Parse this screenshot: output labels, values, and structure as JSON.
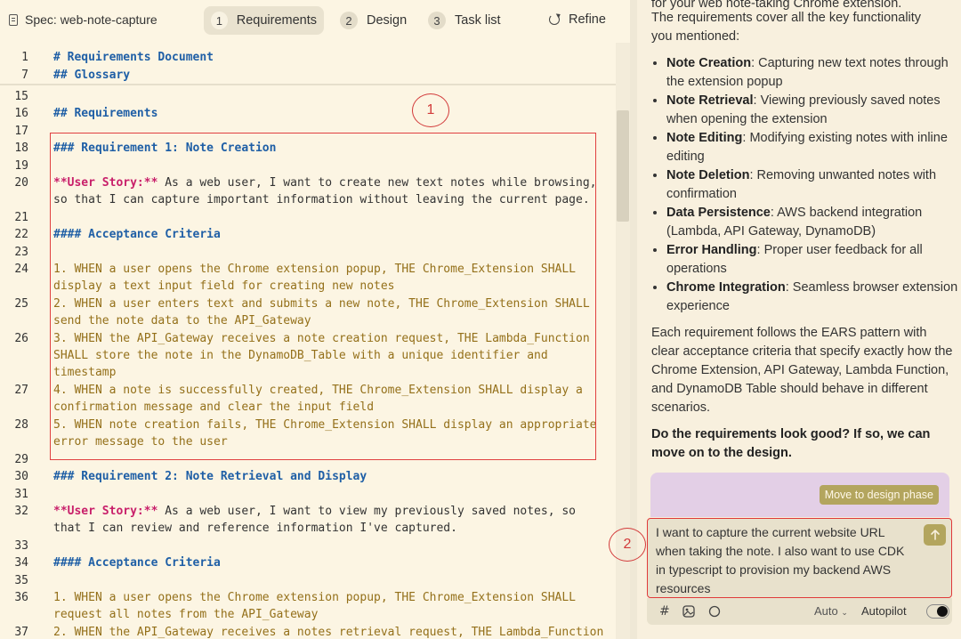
{
  "header": {
    "spec_label": "Spec: web-note-capture",
    "tabs": [
      {
        "num": "1",
        "label": "Requirements",
        "active": true
      },
      {
        "num": "2",
        "label": "Design",
        "active": false
      },
      {
        "num": "3",
        "label": "Task list",
        "active": false
      }
    ],
    "refine_label": "Refine"
  },
  "editor": {
    "lines": [
      {
        "n": "1",
        "parts": [
          {
            "c": "h",
            "t": "# Requirements Document"
          }
        ]
      },
      {
        "n": "7",
        "parts": [
          {
            "c": "h",
            "t": "## Glossary"
          }
        ]
      },
      {
        "n": "15",
        "parts": []
      },
      {
        "n": "16",
        "parts": [
          {
            "c": "h",
            "t": "## Requirements"
          }
        ]
      },
      {
        "n": "17",
        "parts": []
      },
      {
        "n": "18",
        "parts": [
          {
            "c": "h",
            "t": "### Requirement 1: Note Creation"
          }
        ]
      },
      {
        "n": "19",
        "parts": []
      },
      {
        "n": "20",
        "parts": [
          {
            "c": "us",
            "t": "**User Story:**"
          },
          {
            "c": "pl",
            "t": " As a web user, I want to create new text notes while browsing,"
          }
        ]
      },
      {
        "n": "",
        "parts": [
          {
            "c": "pl",
            "t": "so that I can capture important information without leaving the current page."
          }
        ]
      },
      {
        "n": "21",
        "parts": []
      },
      {
        "n": "22",
        "parts": [
          {
            "c": "h",
            "t": "#### Acceptance Criteria"
          }
        ]
      },
      {
        "n": "23",
        "parts": []
      },
      {
        "n": "24",
        "parts": [
          {
            "c": "t",
            "t": "1. WHEN a user opens the Chrome extension popup, THE Chrome_Extension SHALL"
          }
        ]
      },
      {
        "n": "",
        "parts": [
          {
            "c": "t",
            "t": "display a text input field for creating new notes"
          }
        ]
      },
      {
        "n": "25",
        "parts": [
          {
            "c": "t",
            "t": "2. WHEN a user enters text and submits a new note, THE Chrome_Extension SHALL"
          }
        ]
      },
      {
        "n": "",
        "parts": [
          {
            "c": "t",
            "t": "send the note data to the API_Gateway"
          }
        ]
      },
      {
        "n": "26",
        "parts": [
          {
            "c": "t",
            "t": "3. WHEN the API_Gateway receives a note creation request, THE Lambda_Function"
          }
        ]
      },
      {
        "n": "",
        "parts": [
          {
            "c": "t",
            "t": "SHALL store the note in the DynamoDB_Table with a unique identifier and"
          }
        ]
      },
      {
        "n": "",
        "parts": [
          {
            "c": "t",
            "t": "timestamp"
          }
        ]
      },
      {
        "n": "27",
        "parts": [
          {
            "c": "t",
            "t": "4. WHEN a note is successfully created, THE Chrome_Extension SHALL display a"
          }
        ]
      },
      {
        "n": "",
        "parts": [
          {
            "c": "t",
            "t": "confirmation message and clear the input field"
          }
        ]
      },
      {
        "n": "28",
        "parts": [
          {
            "c": "t",
            "t": "5. WHEN note creation fails, THE Chrome_Extension SHALL display an appropriate"
          }
        ]
      },
      {
        "n": "",
        "parts": [
          {
            "c": "t",
            "t": "error message to the user"
          }
        ]
      },
      {
        "n": "29",
        "parts": []
      },
      {
        "n": "30",
        "parts": [
          {
            "c": "h",
            "t": "### Requirement 2: Note Retrieval and Display"
          }
        ]
      },
      {
        "n": "31",
        "parts": []
      },
      {
        "n": "32",
        "parts": [
          {
            "c": "us",
            "t": "**User Story:**"
          },
          {
            "c": "pl",
            "t": " As a web user, I want to view my previously saved notes, so"
          }
        ]
      },
      {
        "n": "",
        "parts": [
          {
            "c": "pl",
            "t": "that I can review and reference information I've captured."
          }
        ]
      },
      {
        "n": "33",
        "parts": []
      },
      {
        "n": "34",
        "parts": [
          {
            "c": "h",
            "t": "#### Acceptance Criteria"
          }
        ]
      },
      {
        "n": "35",
        "parts": []
      },
      {
        "n": "36",
        "parts": [
          {
            "c": "t",
            "t": "1. WHEN a user opens the Chrome extension popup, THE Chrome_Extension SHALL"
          }
        ]
      },
      {
        "n": "",
        "parts": [
          {
            "c": "t",
            "t": "request all notes from the API_Gateway"
          }
        ]
      },
      {
        "n": "37",
        "parts": [
          {
            "c": "t",
            "t": "2. WHEN the API_Gateway receives a notes retrieval request, THE Lambda_Function"
          }
        ]
      }
    ],
    "markers": [
      "1",
      "2"
    ]
  },
  "chat": {
    "intro_line1": "for your web note-taking Chrome extension.",
    "intro_line2": "The requirements cover all the key functionality",
    "intro_line3": "you mentioned:",
    "features": [
      {
        "name": "Note Creation",
        "desc": ": Capturing new text notes through the extension popup"
      },
      {
        "name": "Note Retrieval",
        "desc": ": Viewing previously saved notes when opening the extension"
      },
      {
        "name": "Note Editing",
        "desc": ": Modifying existing notes with inline editing"
      },
      {
        "name": "Note Deletion",
        "desc": ": Removing unwanted notes with confirmation"
      },
      {
        "name": "Data Persistence",
        "desc": ": AWS backend integration (Lambda, API Gateway, DynamoDB)"
      },
      {
        "name": "Error Handling",
        "desc": ": Proper user feedback for all operations"
      },
      {
        "name": "Chrome Integration",
        "desc": ": Seamless browser extension experience"
      }
    ],
    "ears_paragraph": "Each requirement follows the EARS pattern with clear acceptance criteria that specify exactly how the Chrome Extension, API Gateway, Lambda Function, and DynamoDB Table should behave in different scenarios.",
    "question": "Do the requirements look good? If so, we can move on to the design.",
    "move_button": "Move to design phase",
    "input_value": "I want to capture the current website URL when taking the note. I also want to use CDK in typescript to provision my backend AWS resources",
    "auto_label": "Auto",
    "autopilot_label": "Autopilot",
    "icons": [
      "hash-icon",
      "image-icon",
      "circle-icon",
      "send-arrow-icon"
    ],
    "colors": {
      "accent": "#b3a55e",
      "annotation": "#e03a3a"
    }
  }
}
